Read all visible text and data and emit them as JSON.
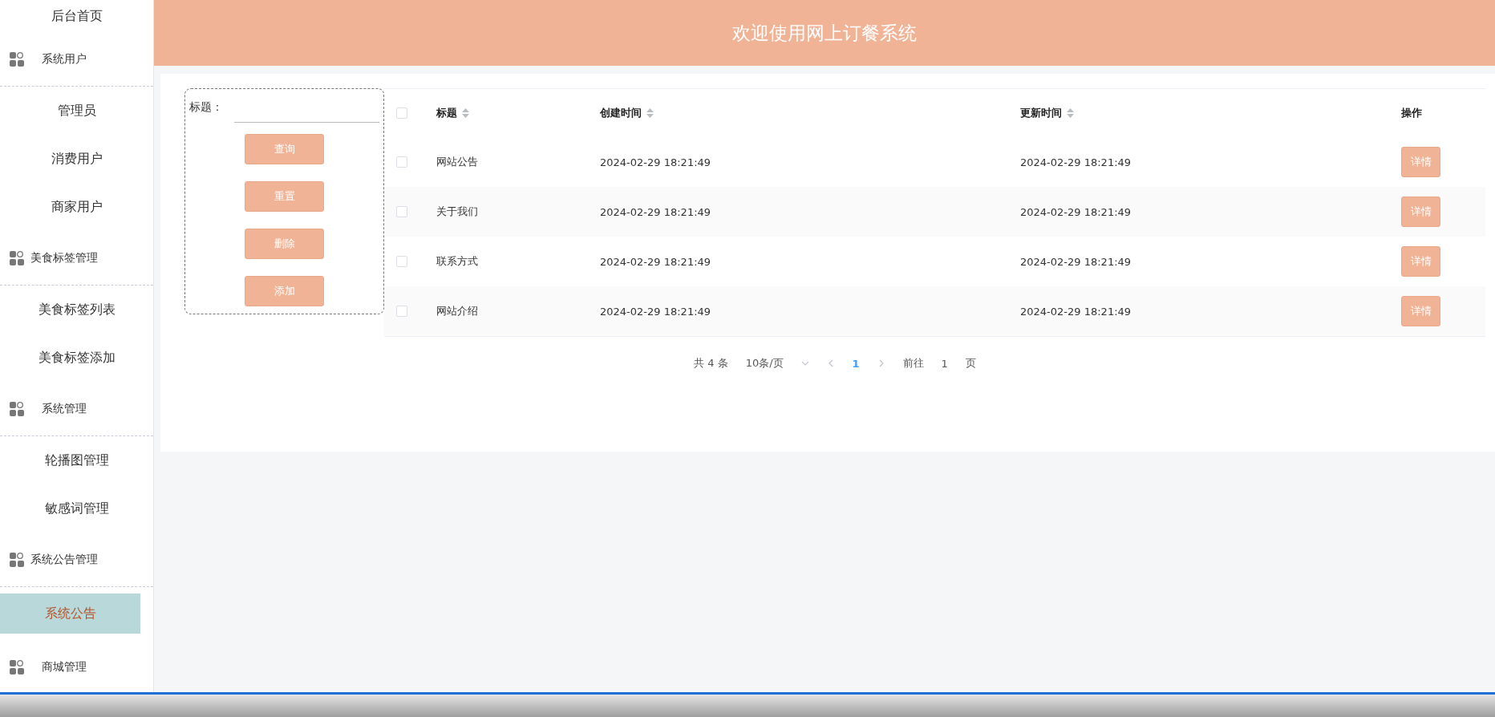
{
  "header": {
    "title": "欢迎使用网上订餐系统"
  },
  "sidebar": {
    "items": [
      {
        "kind": "link",
        "label": "后台首页",
        "selected": false
      },
      {
        "kind": "group",
        "label": "系统用户"
      },
      {
        "kind": "link",
        "label": "管理员",
        "selected": false
      },
      {
        "kind": "link",
        "label": "消费用户",
        "selected": false
      },
      {
        "kind": "link",
        "label": "商家用户",
        "selected": false
      },
      {
        "kind": "group",
        "label": "美食标签管理"
      },
      {
        "kind": "link",
        "label": "美食标签列表",
        "selected": false
      },
      {
        "kind": "link",
        "label": "美食标签添加",
        "selected": false
      },
      {
        "kind": "group",
        "label": "系统管理"
      },
      {
        "kind": "link",
        "label": "轮播图管理",
        "selected": false
      },
      {
        "kind": "link",
        "label": "敏感词管理",
        "selected": false
      },
      {
        "kind": "group",
        "label": "系统公告管理"
      },
      {
        "kind": "link",
        "label": "系统公告",
        "selected": true
      },
      {
        "kind": "group",
        "label": "商城管理"
      }
    ]
  },
  "search": {
    "label": "标题：",
    "buttons": [
      "查询",
      "重置",
      "删除",
      "添加"
    ]
  },
  "table": {
    "select_all": {
      "checked": false
    },
    "columns": [
      {
        "label": "标题",
        "sortable": true
      },
      {
        "label": "创建时间",
        "sortable": true
      },
      {
        "label": "更新时间",
        "sortable": true
      },
      {
        "label": "操作",
        "sortable": false
      }
    ],
    "rows": [
      {
        "checked": false,
        "title": "网站公告",
        "created": "2024-02-29 18:21:49",
        "updated": "2024-02-29 18:21:49",
        "action": "详情"
      },
      {
        "checked": false,
        "title": "关于我们",
        "created": "2024-02-29 18:21:49",
        "updated": "2024-02-29 18:21:49",
        "action": "详情"
      },
      {
        "checked": false,
        "title": "联系方式",
        "created": "2024-02-29 18:21:49",
        "updated": "2024-02-29 18:21:49",
        "action": "详情"
      },
      {
        "checked": false,
        "title": "网站介绍",
        "created": "2024-02-29 18:21:49",
        "updated": "2024-02-29 18:21:49",
        "action": "详情"
      }
    ]
  },
  "pagination": {
    "total": "共 4 条",
    "page_size": "10条/页",
    "pages": [
      {
        "label": "1",
        "selected": true
      }
    ],
    "goto_label": "前往",
    "goto_value": "1",
    "page_suffix": "页"
  }
}
